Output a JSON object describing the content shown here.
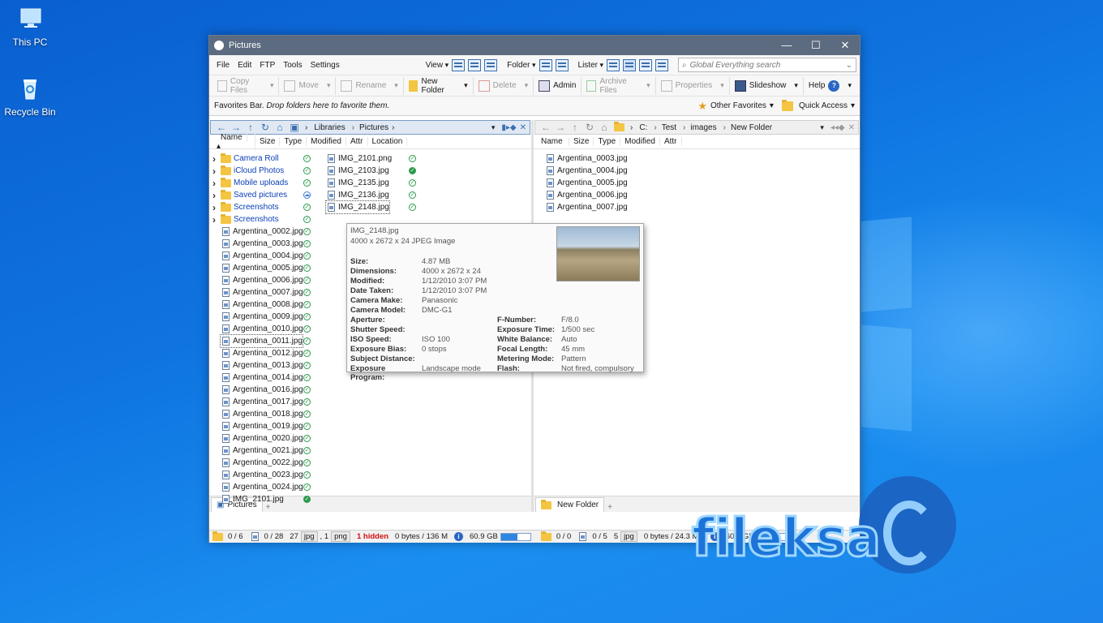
{
  "desktop": {
    "icons": [
      {
        "label": "This PC"
      },
      {
        "label": "Recycle Bin"
      }
    ]
  },
  "window": {
    "title": "Pictures",
    "controls": {
      "minimize": "—",
      "maximize": "☐",
      "close": "✕"
    }
  },
  "menu": {
    "items": [
      "File",
      "Edit",
      "FTP",
      "Tools",
      "Settings"
    ],
    "view": "View",
    "folder": "Folder",
    "lister": "Lister",
    "search_placeholder": "Global Everything search"
  },
  "toolbar": {
    "copy": "Copy Files",
    "move": "Move",
    "rename": "Rename",
    "new_folder": "New Folder",
    "delete": "Delete",
    "admin": "Admin",
    "archive": "Archive Files",
    "properties": "Properties",
    "slideshow": "Slideshow",
    "help": "Help"
  },
  "favbar": {
    "label": "Favorites Bar.",
    "hint": "Drop folders here to favorite them.",
    "other": "Other Favorites",
    "quick": "Quick Access"
  },
  "left_pane": {
    "path": [
      "Libraries",
      "Pictures"
    ],
    "columns": [
      "Name",
      "Size",
      "Type",
      "Modified",
      "Attr",
      "Location"
    ],
    "folders": [
      "Camera Roll",
      "iCloud Photos",
      "Mobile uploads",
      "Saved pictures",
      "Screenshots",
      "Screenshots"
    ],
    "files": [
      "Argentina_0002.jpg",
      "Argentina_0003.jpg",
      "Argentina_0004.jpg",
      "Argentina_0005.jpg",
      "Argentina_0006.jpg",
      "Argentina_0007.jpg",
      "Argentina_0008.jpg",
      "Argentina_0009.jpg",
      "Argentina_0010.jpg",
      "Argentina_0011.jpg",
      "Argentina_0012.jpg",
      "Argentina_0013.jpg",
      "Argentina_0014.jpg",
      "Argentina_0016.jpg",
      "Argentina_0017.jpg",
      "Argentina_0018.jpg",
      "Argentina_0019.jpg",
      "Argentina_0020.jpg",
      "Argentina_0021.jpg",
      "Argentina_0022.jpg",
      "Argentina_0023.jpg",
      "Argentina_0024.jpg",
      "IMG_2101.jpg"
    ],
    "files_col2": [
      "IMG_2101.png",
      "IMG_2103.jpg",
      "IMG_2135.jpg",
      "IMG_2136.jpg",
      "IMG_2148.jpg"
    ],
    "tab": "Pictures"
  },
  "right_pane": {
    "path": [
      "C:",
      "Test",
      "images",
      "New Folder"
    ],
    "columns": [
      "Name",
      "Size",
      "Type",
      "Modified",
      "Attr"
    ],
    "files": [
      "Argentina_0003.jpg",
      "Argentina_0004.jpg",
      "Argentina_0005.jpg",
      "Argentina_0006.jpg",
      "Argentina_0007.jpg"
    ],
    "tab": "New Folder"
  },
  "tooltip": {
    "name": "IMG_2148.jpg",
    "desc": "4000 x 2672 x 24 JPEG Image",
    "left": [
      [
        "Size:",
        "4.87 MB"
      ],
      [
        "Dimensions:",
        "4000 x 2672 x 24"
      ],
      [
        "Modified:",
        "1/12/2010 3:07 PM"
      ],
      [
        "Date Taken:",
        "1/12/2010 3:07 PM"
      ],
      [
        "Camera Make:",
        "Panasonic"
      ],
      [
        "Camera Model:",
        "DMC-G1"
      ],
      [
        "Aperture:",
        ""
      ],
      [
        "Shutter Speed:",
        ""
      ],
      [
        "ISO Speed:",
        "ISO 100"
      ],
      [
        "Exposure Bias:",
        "0 stops"
      ],
      [
        "Subject Distance:",
        ""
      ],
      [
        "Exposure Program:",
        "Landscape mode"
      ]
    ],
    "right": [
      [
        "F-Number:",
        "F/8.0"
      ],
      [
        "Exposure Time:",
        "1/500 sec"
      ],
      [
        "White Balance:",
        "Auto"
      ],
      [
        "Focal Length:",
        "45 mm"
      ],
      [
        "Metering Mode:",
        "Pattern"
      ],
      [
        "Flash:",
        "Not fired, compulsory"
      ]
    ]
  },
  "status": {
    "left": {
      "folders": "0 / 6",
      "files": "0 / 28",
      "jpg_count": "27",
      "jpg": "jpg",
      "png_count": ", 1",
      "png": "png",
      "hidden": "1 hidden",
      "bytes": "0 bytes / 136 M",
      "free": "60.9 GB",
      "fill": 0.55
    },
    "right": {
      "folders": "0 / 0",
      "files": "0 / 5",
      "jpg_count": "5",
      "jpg": "jpg",
      "bytes": "0 bytes / 24.3 MB",
      "free": "60.9 GB",
      "fill": 0.55
    }
  },
  "watermark": "fileks",
  "watermark_tail": "a"
}
